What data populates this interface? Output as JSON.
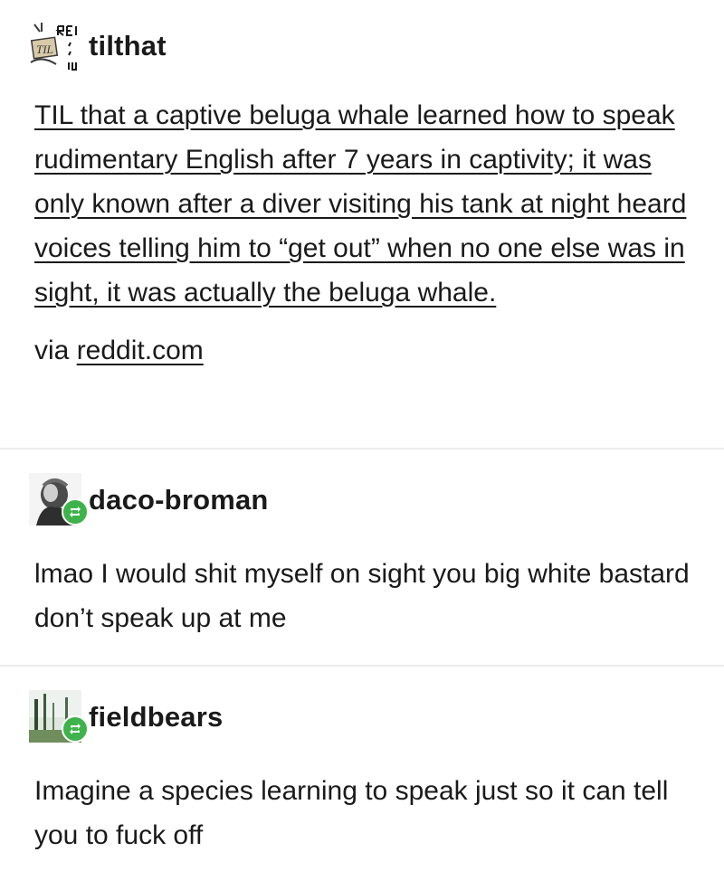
{
  "op": {
    "username": "tilthat",
    "avatar_text": "TIL",
    "body": "TIL that a captive beluga whale learned how to speak rudimentary English after 7 years in captivity; it was only known after a diver visiting his tank at night heard voices telling him to “get out” when no one else was in sight, it was actually the beluga whale.",
    "via_prefix": "via ",
    "via_link": "reddit.com"
  },
  "reblogs": [
    {
      "username": "daco-broman",
      "body": "lmao I would shit myself on sight you big white bastard don’t speak up at me",
      "avatar_icon": "reblog-icon"
    },
    {
      "username": "fieldbears",
      "body": "Imagine a species learning to speak just so it can tell you to fuck off",
      "avatar_icon": "reblog-icon"
    }
  ],
  "colors": {
    "text": "#1a1a1a",
    "divider": "#ececec",
    "reblog_green": "#3eb34b"
  }
}
